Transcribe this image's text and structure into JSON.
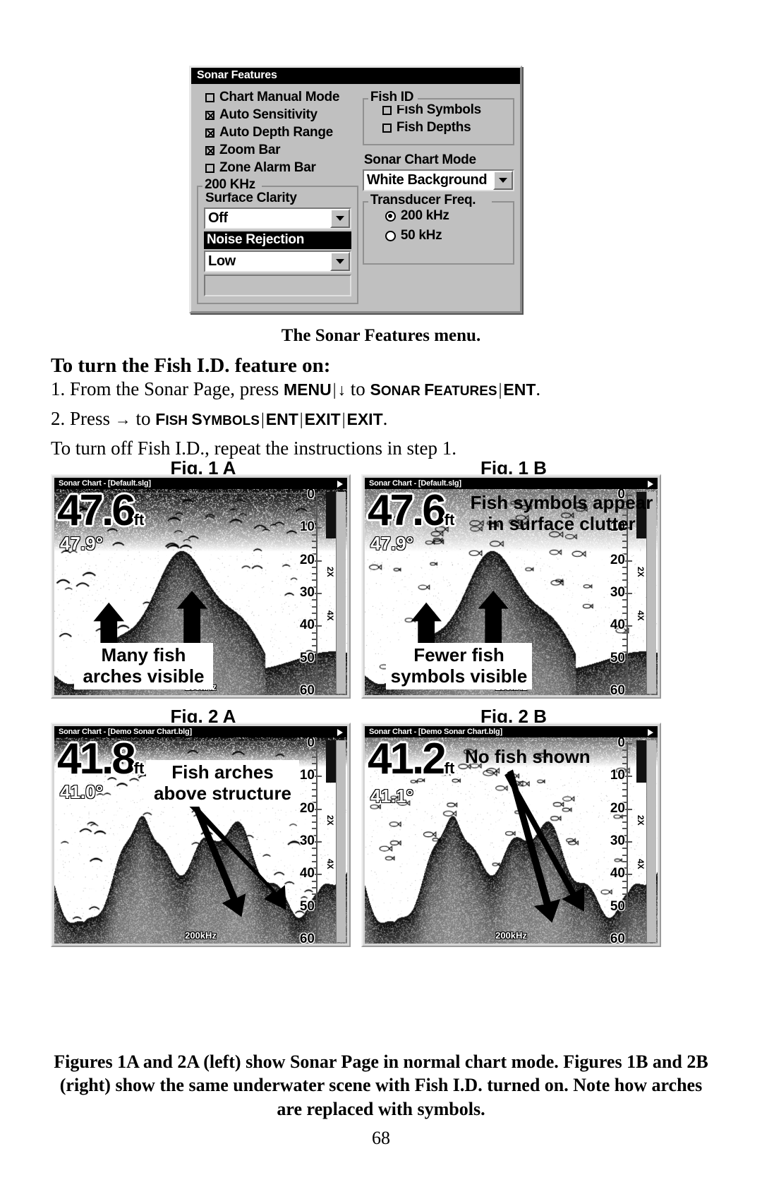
{
  "dialog": {
    "title": "Sonar Features",
    "checkboxes": [
      {
        "label": "Chart Manual Mode",
        "checked": false
      },
      {
        "label": "Auto Sensitivity",
        "checked": true
      },
      {
        "label": "Auto Depth Range",
        "checked": true
      },
      {
        "label": "Zoom Bar",
        "checked": true
      },
      {
        "label": "Zone Alarm Bar",
        "checked": false
      }
    ],
    "khz_group": {
      "title": "200 KHz",
      "surface_clarity_label": "Surface Clarity",
      "surface_clarity_value": "Off",
      "noise_rejection_label": "Noise Rejection",
      "noise_rejection_value": "Low"
    },
    "fish_id_group": {
      "title": "Fish ID",
      "items": [
        {
          "label": "Fish Symbols",
          "checked": false
        },
        {
          "label": "Fish Depths",
          "checked": false
        }
      ]
    },
    "sonar_chart_mode": {
      "label": "Sonar Chart Mode",
      "value": "White Background"
    },
    "transducer_group": {
      "title": "Transducer Freq.",
      "options": [
        {
          "label": "200 kHz",
          "selected": true
        },
        {
          "label": "50 kHz",
          "selected": false
        }
      ]
    }
  },
  "figure_caption": "The Sonar Features menu.",
  "heading": "To turn the Fish I.D. feature on:",
  "steps": {
    "step1": {
      "prefix": "1. From the Sonar Page, press ",
      "key1": "MENU",
      "sep1": "|",
      "arrow": "↓",
      "mid": " to ",
      "target_a": "S",
      "target_b": "ONAR",
      "target_c": "F",
      "target_d": "EATURES",
      "sep2": "|",
      "key2": "ENT",
      "end": "."
    },
    "step2": {
      "prefix": "2. Press ",
      "arrow": "→",
      "mid": " to ",
      "target_a": "F",
      "target_b": "ISH",
      "target_c": "S",
      "target_d": "YMBOLS",
      "sep1": "|",
      "key1": "ENT",
      "sep2": "|",
      "key2": "EXIT",
      "sep3": "|",
      "key3": "EXIT",
      "end": "."
    },
    "step3": "To turn off Fish I.D., repeat the instructions in step 1."
  },
  "figures": [
    {
      "label": "Fig. 1 A",
      "titlebar": "Sonar Chart - [Default.slg]",
      "depth": "47.6",
      "depth_unit": "ft",
      "temperature": "47.9°",
      "frequency": "200kHz",
      "callout": "Many fish\narches visible",
      "callout_line1": "Many fish",
      "callout_line2": "arches visible",
      "scale_labels": [
        "0",
        "10",
        "20",
        "30",
        "40",
        "50",
        "60"
      ],
      "zoom_labels": [
        "2X",
        "4X"
      ]
    },
    {
      "label": "Fig. 1 B",
      "titlebar": "Sonar Chart - [Default.slg]",
      "depth": "47.6",
      "depth_unit": "ft",
      "temperature": "47.9°",
      "frequency": "200kHz",
      "top_callout_line1": "Fish symbols appear",
      "top_callout_line2": "in surface clutter",
      "callout_line1": "Fewer fish",
      "callout_line2": "symbols visible",
      "scale_labels": [
        "0",
        "10",
        "20",
        "30",
        "40",
        "50",
        "60"
      ],
      "zoom_labels": [
        "2X",
        "4X"
      ]
    },
    {
      "label": "Fig. 2 A",
      "titlebar": "Sonar Chart - [Demo Sonar Chart.blg]",
      "depth": "41.8",
      "depth_unit": "ft",
      "temperature": "41.0°",
      "frequency": "200kHz",
      "callout_line1": "Fish arches",
      "callout_line2": "above structure",
      "scale_labels": [
        "0",
        "10",
        "20",
        "30",
        "40",
        "50",
        "60"
      ],
      "zoom_labels": [
        "2X",
        "4X"
      ]
    },
    {
      "label": "Fig. 2 B",
      "titlebar": "Sonar Chart - [Demo Sonar Chart.blg]",
      "depth": "41.2",
      "depth_unit": "ft",
      "temperature": "41.1°",
      "frequency": "200kHz",
      "callout_line1": "No fish shown",
      "scale_labels": [
        "0",
        "10",
        "20",
        "30",
        "40",
        "50",
        "60"
      ],
      "zoom_labels": [
        "2X",
        "4X"
      ]
    }
  ],
  "bottom_caption": "Figures 1A and 2A (left) show Sonar Page in normal chart mode. Figures 1B and 2B (right) show the same underwater scene with Fish I.D. turned on. Note how arches are replaced with symbols.",
  "page_number": "68"
}
